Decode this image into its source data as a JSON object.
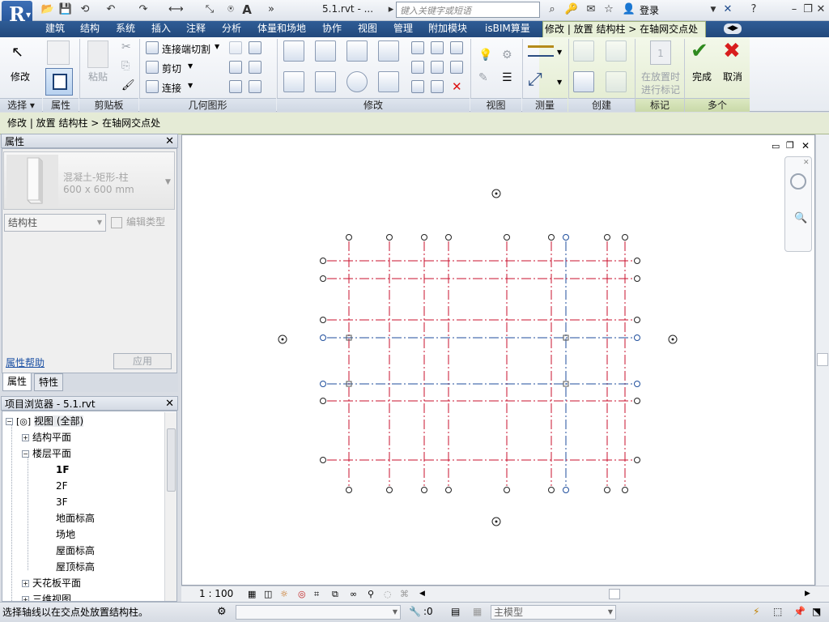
{
  "titlebar": {
    "logo": "R",
    "doc_title": "5.1.rvt - ...",
    "search_placeholder": "键入关键字或短语",
    "login": "登录"
  },
  "tabs": [
    "建筑",
    "结构",
    "系统",
    "插入",
    "注释",
    "分析",
    "体量和场地",
    "协作",
    "视图",
    "管理",
    "附加模块",
    "isBIM算量",
    "修改 | 放置 结构柱 > 在轴网交点处"
  ],
  "ribbon": {
    "modify": "修改",
    "paste": "粘贴",
    "cope_cut": "连接端切割",
    "cut": "剪切",
    "join": "连接",
    "at_tags_line1": "在放置时",
    "at_tags_line2": "进行标记",
    "finish": "完成",
    "cancel": "取消",
    "panels": [
      "选择",
      "属性",
      "剪贴板",
      "几何图形",
      "修改",
      "视图",
      "测量",
      "创建",
      "标记",
      "多个"
    ]
  },
  "optionsbar": {
    "text": "修改 | 放置 结构柱 > 在轴网交点处"
  },
  "properties": {
    "title": "属性",
    "type_line1": "混凝土-矩形-柱",
    "type_line2": "600 x 600 mm",
    "category": "结构柱",
    "edit_type": "编辑类型",
    "help": "属性帮助",
    "apply": "应用",
    "tabs": [
      "属性",
      "特性"
    ]
  },
  "browser": {
    "title": "项目浏览器 - 5.1.rvt",
    "items": [
      "视图 (全部)",
      "结构平面",
      "楼层平面",
      "1F",
      "2F",
      "3F",
      "地面标高",
      "场地",
      "屋面标高",
      "屋顶标高",
      "天花板平面",
      "三维视图"
    ]
  },
  "viewbar": {
    "scale": "1 : 100"
  },
  "status": {
    "message": "选择轴线以在交点处放置结构柱。",
    "worksets": ":0",
    "model": "主模型"
  },
  "grid": {
    "red_color": "#c8102e",
    "blue_color": "#1f4e9c"
  }
}
